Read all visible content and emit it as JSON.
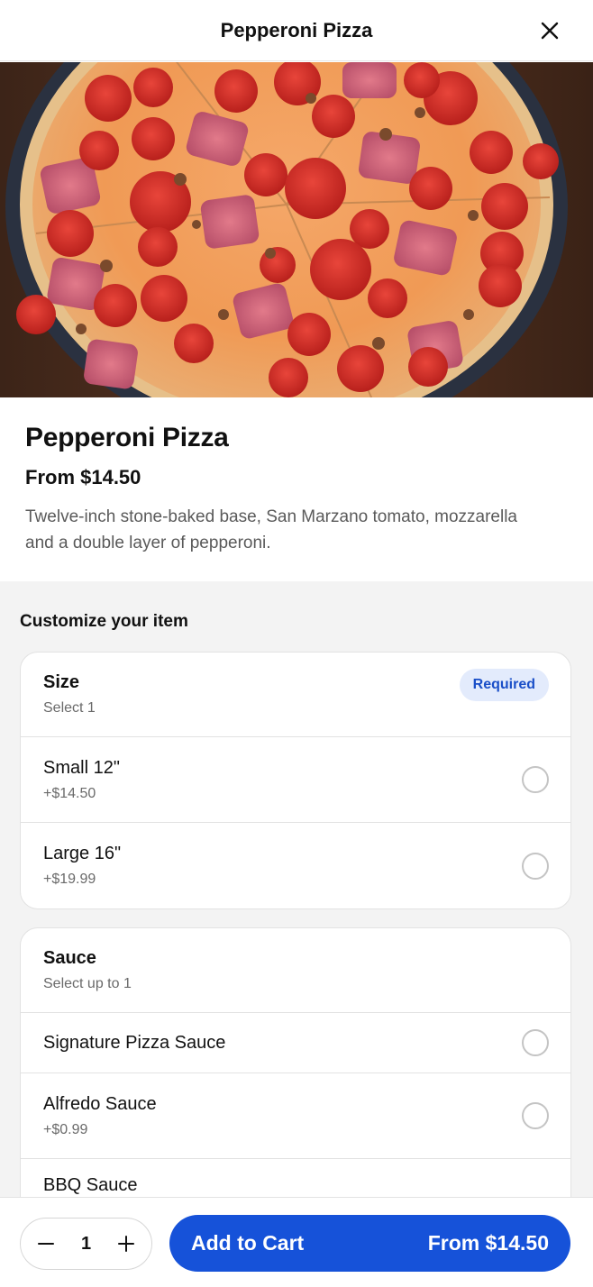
{
  "header": {
    "title": "Pepperoni Pizza"
  },
  "item": {
    "title": "Pepperoni Pizza",
    "price": "From $14.50",
    "description": "Twelve-inch stone-baked base, San Marzano tomato, mozzarella and a double layer of pepperoni."
  },
  "customize": {
    "title": "Customize your item",
    "groups": [
      {
        "name": "Size",
        "sub": "Select 1",
        "badge": "Required",
        "options": [
          {
            "name": "Small 12\"",
            "price": "+$14.50"
          },
          {
            "name": "Large 16\"",
            "price": "+$19.99"
          }
        ]
      },
      {
        "name": "Sauce",
        "sub": "Select up to 1",
        "options": [
          {
            "name": "Signature Pizza Sauce"
          },
          {
            "name": "Alfredo Sauce",
            "price": "+$0.99"
          },
          {
            "name": "BBQ Sauce"
          }
        ]
      }
    ]
  },
  "footer": {
    "quantity": "1",
    "add_label": "Add to Cart",
    "add_price": "From $14.50"
  },
  "colors": {
    "primary": "#1652d9",
    "badge_bg": "#e3ebfc",
    "badge_text": "#1a4fc8",
    "section_bg": "#f3f3f3"
  },
  "icons": {
    "close": "close-icon",
    "minus": "minus-icon",
    "plus": "plus-icon"
  }
}
